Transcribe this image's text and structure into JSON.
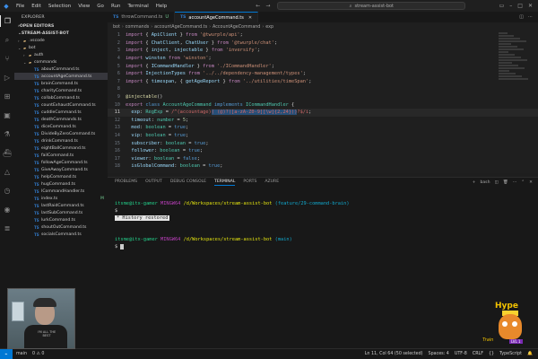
{
  "titlebar": {
    "menu": [
      "File",
      "Edit",
      "Selection",
      "View",
      "Go",
      "Run",
      "Terminal",
      "Help"
    ],
    "search_text": "stream-assist-bot"
  },
  "sidebar": {
    "header": "EXPLORER",
    "open_editors": "OPEN EDITORS",
    "project": "STREAM-ASSIST-BOT",
    "folders": [
      ".vscode",
      "bot",
      "auth",
      "commands"
    ],
    "files": [
      "aboutCommand.ts",
      "accountAgeCommand.ts",
      "brainCommand.ts",
      "charityCommand.ts",
      "collabCommand.ts",
      "countExhaustCommand.ts",
      "cuddleCommand.ts",
      "deathCommands.ts",
      "diceCommand.ts",
      "DivideByZeroCommand.ts",
      "drinkCommand.ts",
      "eightBallCommand.ts",
      "failCommand.ts",
      "followAgeCommand.ts",
      "GiveAwayCommand.ts",
      "helpCommand.ts",
      "hugCommand.ts",
      "ICommandHandler.ts",
      "index.ts",
      "lastRaidCommand.ts",
      "lastSubCommand.ts",
      "lurkCommand.ts",
      "shoutOutCommand.ts",
      "socialsCommand.ts"
    ],
    "selected_index": 1,
    "modified_badge": "M",
    "modified_index": 18
  },
  "tabs": [
    {
      "label": "throwCommand.ts",
      "dirty": "U",
      "active": false
    },
    {
      "label": "accountAgeCommand.ts",
      "dirty": "",
      "active": true
    }
  ],
  "breadcrumb": [
    "bot",
    "commands",
    "accountAgeCommand.ts",
    "AccountAgeCommand",
    "exp"
  ],
  "editor": {
    "lines": [
      {
        "n": "1",
        "html": "<span class='k'>import</span> { <span class='v'>ApiClient</span> } <span class='k'>from</span> <span class='s'>'@twurple/api'</span>;"
      },
      {
        "n": "2",
        "html": "<span class='k'>import</span> { <span class='v'>ChatClient</span>, <span class='v'>ChatUser</span> } <span class='k'>from</span> <span class='s'>'@twurple/chat'</span>;"
      },
      {
        "n": "3",
        "html": "<span class='k'>import</span> { <span class='v'>inject</span>, <span class='v'>injectable</span> } <span class='k'>from</span> <span class='s'>'inversify'</span>;"
      },
      {
        "n": "4",
        "html": "<span class='k'>import</span> <span class='v'>winston</span> <span class='k'>from</span> <span class='s'>'winston'</span>;"
      },
      {
        "n": "5",
        "html": "<span class='k'>import</span> { <span class='v'>ICommandHandler</span> } <span class='k'>from</span> <span class='s'>'./ICommandHandler'</span>;"
      },
      {
        "n": "6",
        "html": "<span class='k'>import</span> <span class='v'>InjectionTypes</span> <span class='k'>from</span> <span class='s'>'../../dependency-management/types'</span>;"
      },
      {
        "n": "7",
        "html": "<span class='k'>import</span> { <span class='v'>timespan</span>, { <span class='v'>getAgeReport</span> } <span class='k'>from</span> <span class='s'>'../utilities/timeSpan'</span>;"
      },
      {
        "n": "8",
        "html": ""
      },
      {
        "n": "9",
        "html": "<span class='dec'>@injectable</span>()"
      },
      {
        "n": "10",
        "html": "<span class='k'>export</span> <span class='kb'>class</span> <span class='t'>AccountAgeCommand</span> <span class='kb'>implements</span> <span class='t'>ICommandHandler</span> {"
      },
      {
        "n": "11",
        "html": "  <span class='v'>exp</span>: <span class='t'>RegExp</span> = <span class='r'>/^(accountage)</span><span class='sel'><span class='r'>( (@)?([a-zA-Z0-9][\\w]{2,24}))</span></span><span class='r'>?$/i</span>;",
        "cur": true
      },
      {
        "n": "12",
        "html": "  <span class='v'>timeout</span>: <span class='t'>number</span> = <span class='n'>5</span>;"
      },
      {
        "n": "13",
        "html": "  <span class='v'>mod</span>: <span class='t'>boolean</span> = <span class='kb'>true</span>;"
      },
      {
        "n": "14",
        "html": "  <span class='v'>vip</span>: <span class='t'>boolean</span> = <span class='kb'>true</span>;"
      },
      {
        "n": "15",
        "html": "  <span class='v'>subscriber</span>: <span class='t'>boolean</span> = <span class='kb'>true</span>;"
      },
      {
        "n": "16",
        "html": "  <span class='v'>follower</span>: <span class='t'>boolean</span> = <span class='kb'>true</span>;"
      },
      {
        "n": "17",
        "html": "  <span class='v'>viewer</span>: <span class='t'>boolean</span> = <span class='kb'>false</span>;"
      },
      {
        "n": "18",
        "html": "  <span class='v'>isGlobalCommand</span>: <span class='t'>boolean</span> = <span class='kb'>true</span>;"
      }
    ]
  },
  "panel": {
    "tabs": [
      "PROBLEMS",
      "OUTPUT",
      "DEBUG CONSOLE",
      "TERMINAL",
      "PORTS",
      "AZURE"
    ],
    "active_tab": "TERMINAL",
    "shell_label": "bash"
  },
  "terminal": {
    "prompt1_user": "itsme@itx-gamer",
    "prompt1_env": "MINGW64",
    "prompt1_path": "/d/Workspaces/stream-assist-bot",
    "prompt1_branch": "(feature/29-command-brain)",
    "dollar": "$",
    "restored_star": "*",
    "restored_text": "History restored",
    "prompt2_user": "itsme@itx-gamer",
    "prompt2_env": "MINGW64",
    "prompt2_path": "/d/Workspaces/stream-assist-bot",
    "prompt2_branch": "(main)"
  },
  "statusbar": {
    "left": [
      "main",
      "0 ⚠ 0"
    ],
    "right": [
      "Ln 11, Col 64 (50 selected)",
      "Spaces: 4",
      "UTF-8",
      "CRLF",
      "{}",
      "TypeScript"
    ]
  },
  "overlay": {
    "shirt_text": "I'M ALL THE BEST",
    "hype_label": "Hype",
    "hype_sub": "Train",
    "hype_level": "LVL 1"
  }
}
